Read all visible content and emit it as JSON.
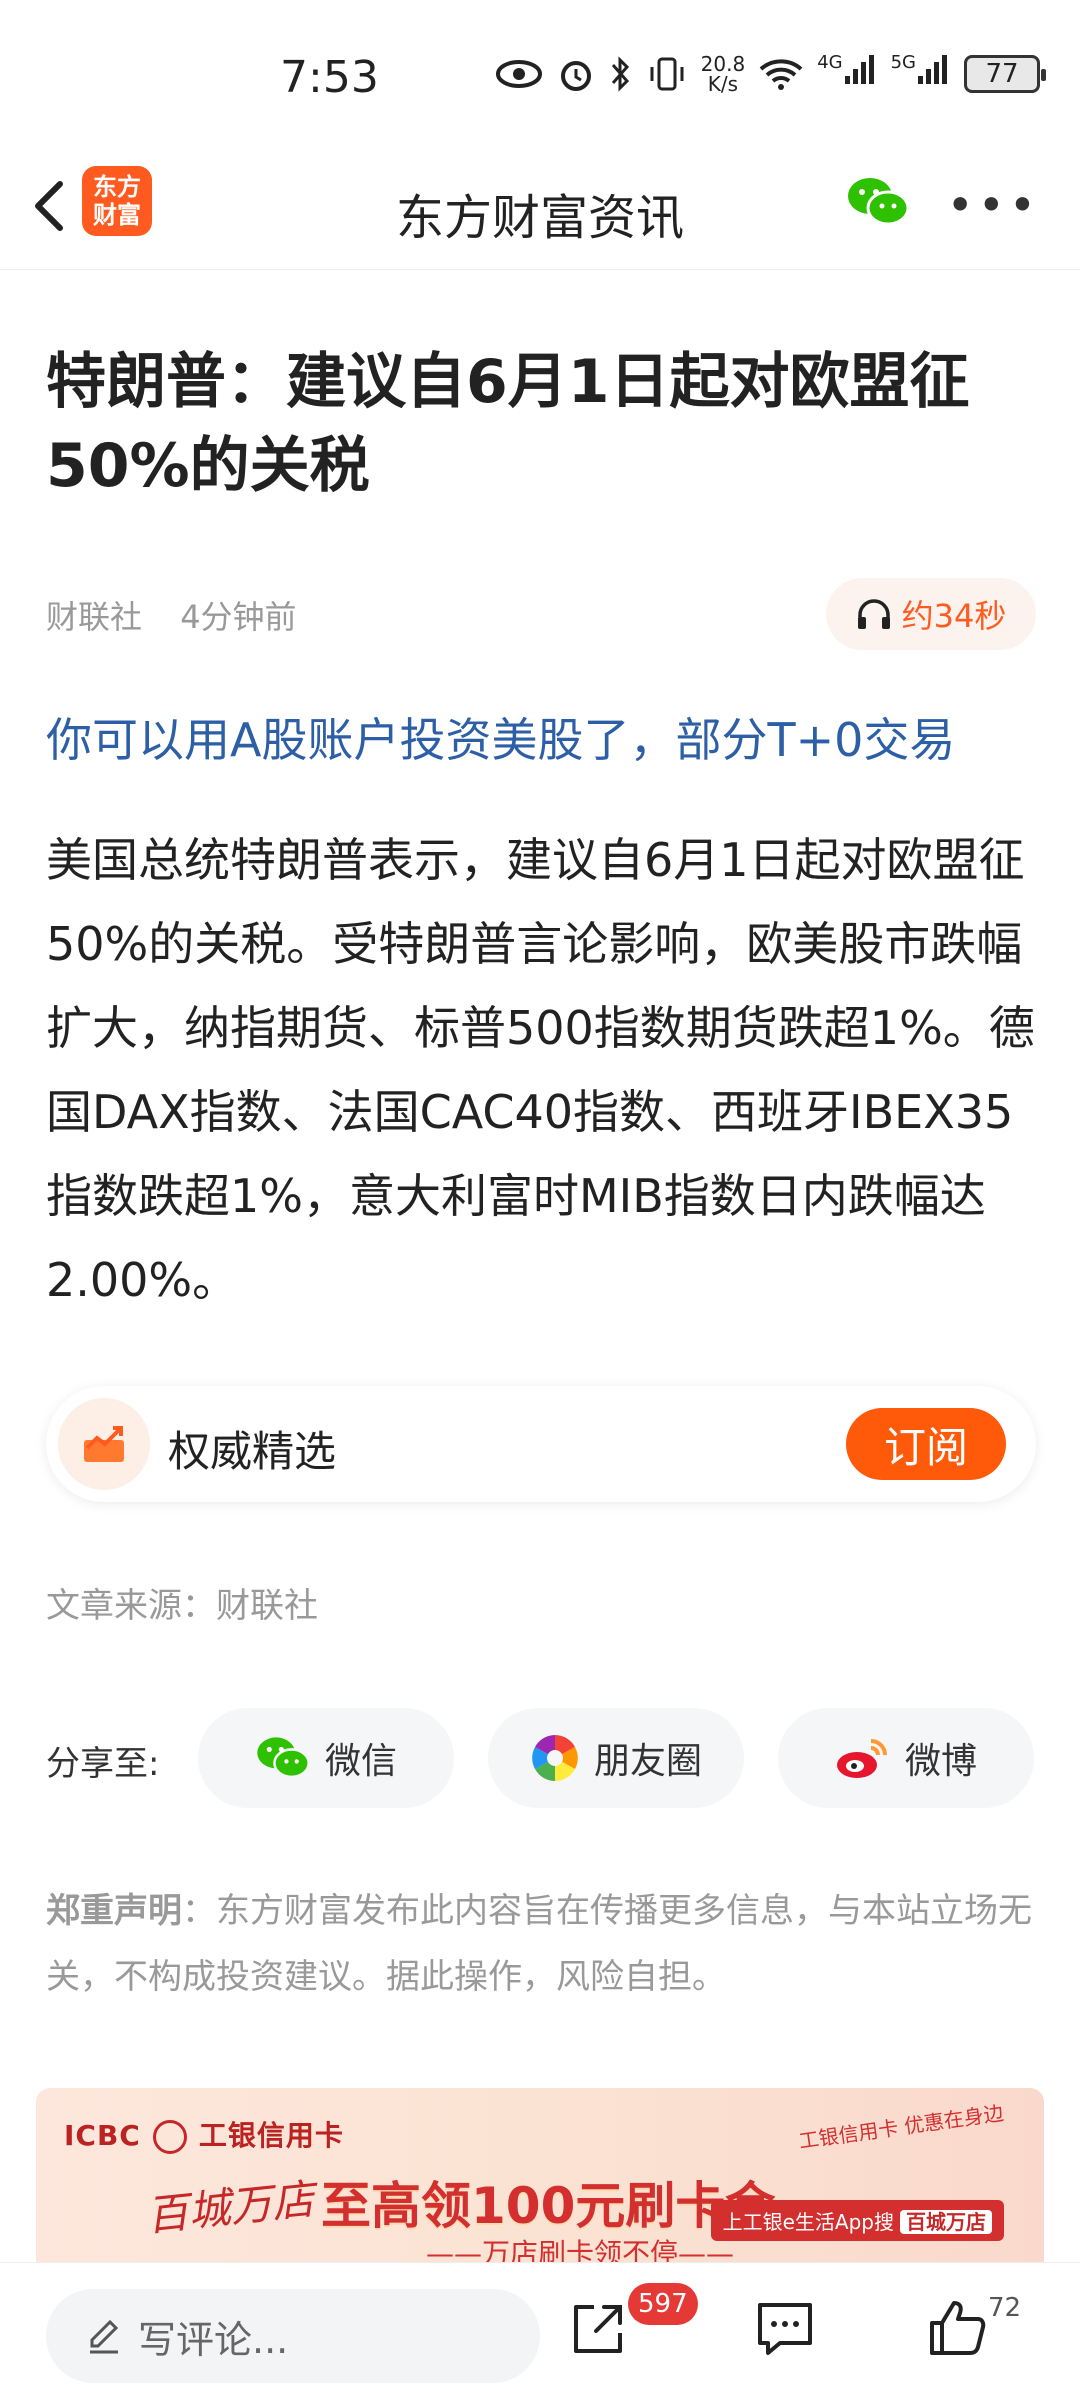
{
  "status_bar": {
    "time": "7:53",
    "net_speed_value": "20.8",
    "net_speed_unit": "K/s",
    "signal_4g": "4G",
    "signal_5g": "5G",
    "battery": "77",
    "icons": [
      "eye-icon",
      "alarm-icon",
      "bluetooth-icon",
      "vibrate-icon",
      "wifi-icon",
      "signal-icon",
      "battery-icon"
    ]
  },
  "nav": {
    "logo_line1": "东方",
    "logo_line2": "财富",
    "title": "东方财富资讯"
  },
  "article": {
    "headline": "特朗普：建议自6月1日起对欧盟征50%的关税",
    "source_name": "财联社",
    "time_ago": "4分钟前",
    "audio_label": "约34秒",
    "promo_link": "你可以用A股账户投资美股了，部分T+0交易",
    "body": "美国总统特朗普表示，建议自6月1日起对欧盟征50%的关税。受特朗普言论影响，欧美股市跌幅扩大，纳指期货、标普500指数期货跌超1%。德国DAX指数、法国CAC40指数、西班牙IBEX35指数跌超1%，意大利富时MIB指数日内跌幅达2.00%。"
  },
  "subscription": {
    "title": "权威精选",
    "button": "订阅"
  },
  "source_line": "文章来源：财联社",
  "share": {
    "label": "分享至:",
    "wechat": "微信",
    "moments": "朋友圈",
    "weibo": "微博"
  },
  "disclaimer": {
    "title": "郑重声明",
    "text": "：东方财富发布此内容旨在传播更多信息，与本站立场无关，不构成投资建议。据此操作，风险自担。"
  },
  "ad": {
    "brand_left": "ICBC",
    "brand_right": "工银信用卡",
    "slogan": "百城万店",
    "headline": "至高领100元刷卡金",
    "subline": "——万店刷卡领不停——",
    "right_text": "上工银e生活App搜",
    "right_highlight": "百城万店",
    "tag_top": "工银信用卡 优惠在身边"
  },
  "bottom_bar": {
    "comment_placeholder": "写评论...",
    "share_count": "597",
    "like_count": "72"
  },
  "colors": {
    "brand_orange": "#ff5a1f",
    "link_blue": "#2d5fa6",
    "badge_red": "#e53935"
  }
}
